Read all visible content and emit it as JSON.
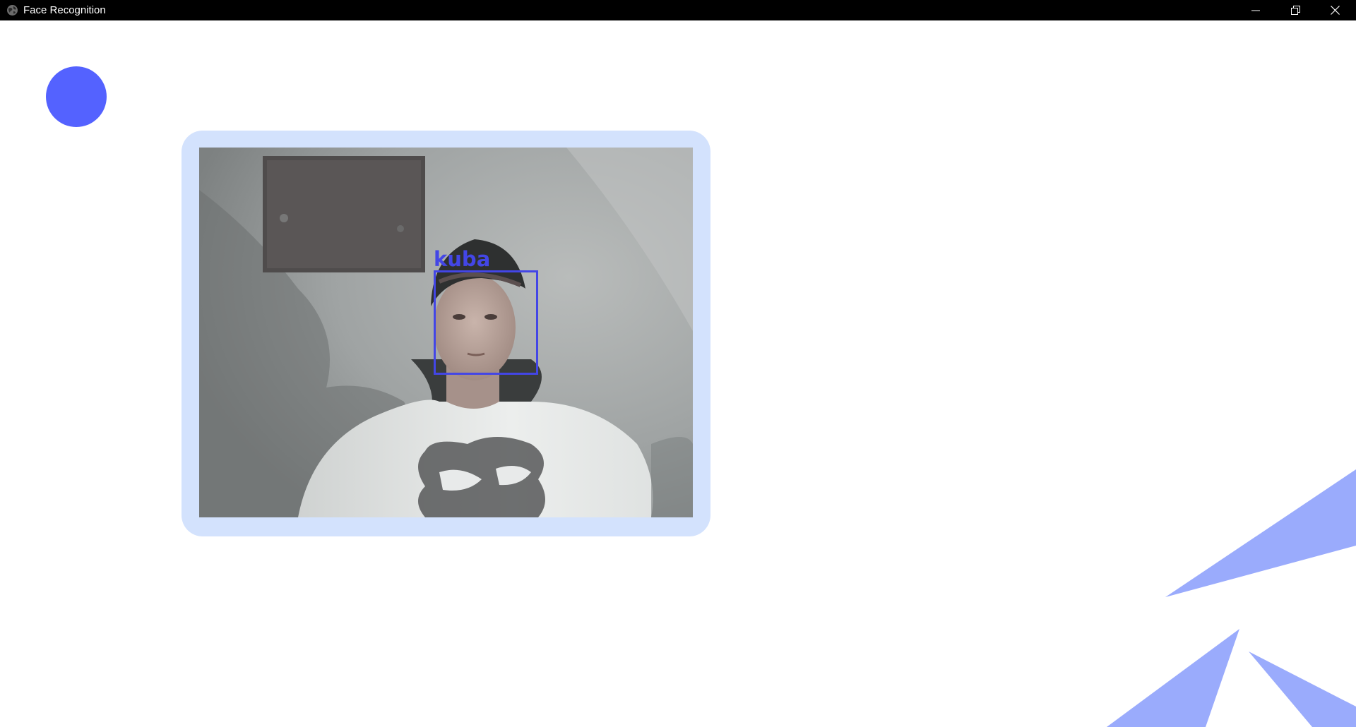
{
  "window": {
    "title": "Face Recognition",
    "icon": "globe-icon",
    "controls": [
      "minimize-icon",
      "restore-icon",
      "close-icon"
    ]
  },
  "colors": {
    "titlebar": "#000000",
    "accent_dot": "#5462ff",
    "frame": "#d3e2fd",
    "detection_box": "#4346e6",
    "triangles": "#9aabfc"
  },
  "video": {
    "detections": [
      {
        "label": "kuba"
      }
    ]
  }
}
